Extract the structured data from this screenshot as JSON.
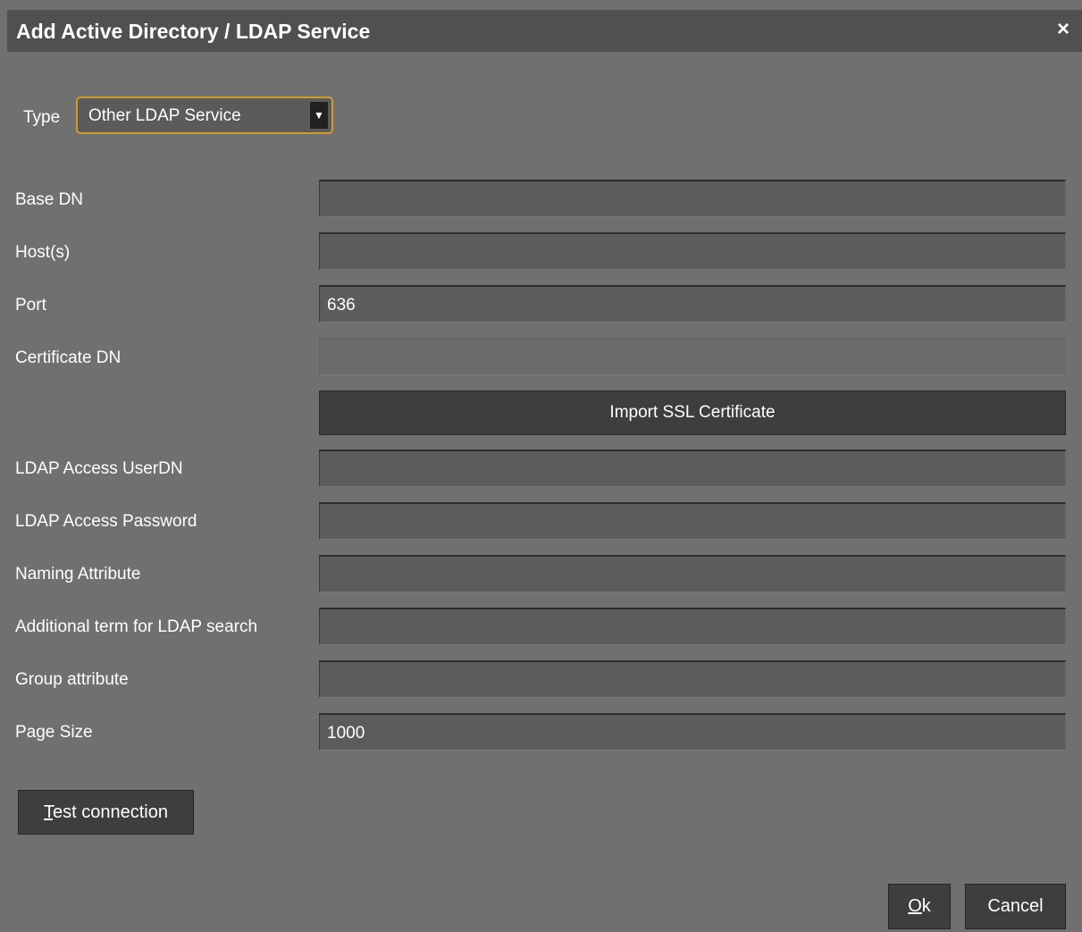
{
  "dialog": {
    "title": "Add Active Directory / LDAP Service",
    "close_glyph": "×"
  },
  "type": {
    "label": "Type",
    "selected": "Other LDAP Service",
    "arrow_glyph": "▼"
  },
  "fields": {
    "base_dn": {
      "label": "Base DN",
      "value": ""
    },
    "hosts": {
      "label": "Host(s)",
      "value": ""
    },
    "port": {
      "label": "Port",
      "value": "636"
    },
    "certificate_dn": {
      "label": "Certificate DN",
      "value": ""
    },
    "ldap_access_userdn": {
      "label": "LDAP Access UserDN",
      "value": ""
    },
    "ldap_access_password": {
      "label": "LDAP Access Password",
      "value": ""
    },
    "naming_attribute": {
      "label": "Naming Attribute",
      "value": ""
    },
    "additional_term": {
      "label": "Additional term for LDAP search",
      "value": ""
    },
    "group_attribute": {
      "label": "Group attribute",
      "value": ""
    },
    "page_size": {
      "label": "Page Size",
      "value": "1000"
    }
  },
  "buttons": {
    "import_ssl": "Import SSL Certificate",
    "test_mnemonic": "T",
    "test_rest": "est connection",
    "ok_mnemonic": "O",
    "ok_rest": "k",
    "cancel": "Cancel"
  },
  "colors": {
    "dialog_bg": "#707070",
    "titlebar_bg": "#505050",
    "field_bg": "#5c5c5c",
    "button_bg": "#3e3e3e",
    "focus_border": "#d19a2a"
  }
}
